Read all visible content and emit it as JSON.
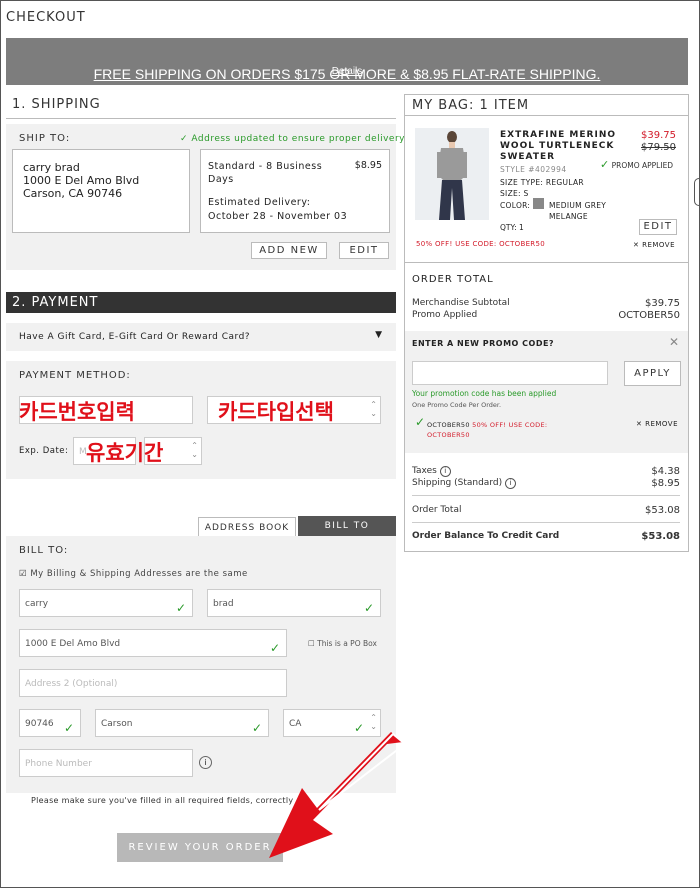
{
  "page": {
    "title": "CHECKOUT"
  },
  "banner": {
    "text": "FREE SHIPPING ON ORDERS $175 OR MORE & $8.95 FLAT-RATE SHIPPING.",
    "details": "Details"
  },
  "shipping": {
    "heading": "1. SHIPPING",
    "ship_to_label": "SHIP TO:",
    "address_updated": "Address updated to ensure proper delivery",
    "address": {
      "name": "carry brad",
      "street": "1000 E Del Amo Blvd",
      "city": "Carson, CA 90746"
    },
    "method": {
      "name": "Standard - 8 Business Days",
      "price": "$8.95",
      "est_label": "Estimated Delivery:",
      "est_dates": "October 28 - November 03"
    },
    "add_new": "ADD NEW",
    "edit": "EDIT"
  },
  "payment": {
    "heading": "2. PAYMENT",
    "gift_card": "Have A Gift Card, E-Gift Card Or Reward Card?",
    "method_label": "PAYMENT METHOD:",
    "card_number_note": "카드번호입력",
    "card_type_note": "카드타입선택",
    "exp_label": "Exp. Date:",
    "exp_month_placeholder": "M",
    "expiry_note": "유효기간"
  },
  "bill": {
    "tab_address_book": "ADDRESS BOOK",
    "tab_bill_to": "BILL TO",
    "label": "BILL TO:",
    "same_address": "My Billing & Shipping Addresses are the same",
    "first_name": "carry",
    "last_name": "brad",
    "address1": "1000 E Del Amo Blvd",
    "po_box": "This is a PO Box",
    "address2_placeholder": "Address 2 (Optional)",
    "zip": "90746",
    "city": "Carson",
    "state": "CA",
    "phone_placeholder": "Phone Number"
  },
  "footer": {
    "notice": "Please make sure you've filled in all required fields, correctly",
    "review_button": "REVIEW YOUR ORDER"
  },
  "bag": {
    "heading": "MY BAG: 1 ITEM",
    "item": {
      "name_line1": "EXTRAFINE MERINO",
      "name_line2": "WOOL TURTLENECK",
      "name_line3": "SWEATER",
      "price_sale": "$39.75",
      "price_orig": "$79.50",
      "promo_applied": "PROMO APPLIED",
      "style": "STYLE #402994",
      "size_type": "SIZE TYPE: REGULAR",
      "size": "SIZE: S",
      "color_label": "COLOR:",
      "color_line1": "MEDIUM GREY",
      "color_line2": "MELANGE",
      "qty": "QTY: 1",
      "edit": "EDIT",
      "promo_note": "50% OFF! USE CODE: OCTOBER50",
      "remove": "REMOVE"
    },
    "order_total_label": "ORDER TOTAL",
    "merch_subtotal_label": "Merchandise Subtotal",
    "merch_subtotal": "$39.75",
    "promo_applied_label": "Promo Applied",
    "promo_code": "OCTOBER50",
    "enter_promo": "ENTER A NEW PROMO CODE?",
    "apply": "APPLY",
    "promo_success": "Your promotion code has been applied",
    "one_per_order": "One Promo Code Per Order.",
    "applied_code": "OCTOBER50",
    "applied_desc": "50% OFF! USE CODE:",
    "applied_code2": "OCTOBER50",
    "remove": "REMOVE",
    "taxes_label": "Taxes",
    "taxes": "$4.38",
    "shipping_label": "Shipping (Standard)",
    "shipping": "$8.95",
    "order_total_row_label": "Order Total",
    "order_total": "$53.08",
    "balance_label": "Order Balance To Credit Card",
    "balance": "$53.08"
  },
  "colors": {
    "banner": "#7d7d7d",
    "sale_red": "#d31b2a",
    "check_green": "#2a9a2a",
    "annotation_red": "#e0101a",
    "payment_header": "#333333"
  }
}
